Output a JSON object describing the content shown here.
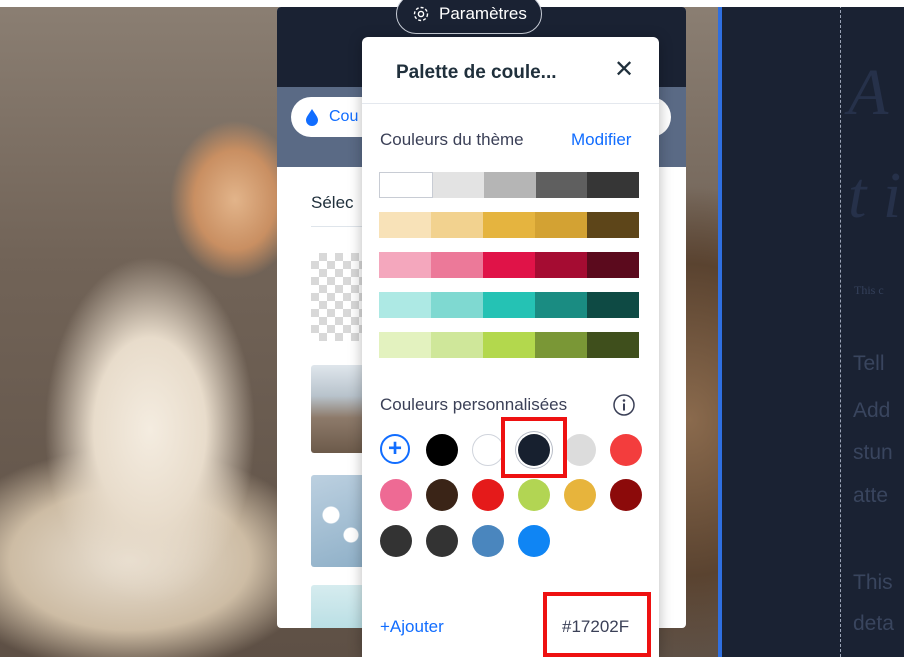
{
  "settings": {
    "label": "Paramètres",
    "icon": "gear-icon"
  },
  "side_panel": {
    "tab_label": "Cou",
    "tab_icon": "drop-icon",
    "select_label": "Sélec"
  },
  "palette": {
    "title": "Palette de coule...",
    "close_icon": "close-icon",
    "theme_label": "Couleurs du thème",
    "modify_label": "Modifier",
    "theme_rows": [
      [
        "#ffffff",
        "#e3e3e3",
        "#b5b5b5",
        "#5f5f5f",
        "#363636"
      ],
      [
        "#f8e2b8",
        "#f2d28f",
        "#e5b43f",
        "#d3a233",
        "#5d4519"
      ],
      [
        "#f4a7bd",
        "#ec7999",
        "#e01348",
        "#a50c32",
        "#5b0a1d"
      ],
      [
        "#ade9e4",
        "#7fd9d1",
        "#25c2b4",
        "#1a8c82",
        "#0e4a44"
      ],
      [
        "#e3f2bf",
        "#cfe79a",
        "#b3d84d",
        "#7a9736",
        "#3f4f1c"
      ]
    ],
    "custom_label": "Couleurs personnalisées",
    "info_icon": "info-icon",
    "add_icon": "plus-icon",
    "custom_colors": [
      "#000000",
      "#ffffff",
      "#17202f",
      "#dcdcdc",
      "#f33d3d",
      "#ee6a94",
      "#3a2417",
      "#e51a1a",
      "#b2d553",
      "#e7b43c",
      "#8c0a0a",
      "#333333",
      "#333333",
      "#4a86be",
      "#0f85f4"
    ],
    "selected_color_index": 2,
    "add_label": "+Ajouter",
    "hex_value": "#17202F"
  },
  "canvas": {
    "big_letters": [
      "A",
      "t i"
    ],
    "small_line": "This c",
    "body_lines": [
      "Tell",
      "Add",
      "stun",
      "atte",
      "This",
      "deta"
    ]
  },
  "colors": {
    "accent": "#116dff",
    "editor_dark": "#1a2233",
    "annotation": "#ee1111"
  }
}
